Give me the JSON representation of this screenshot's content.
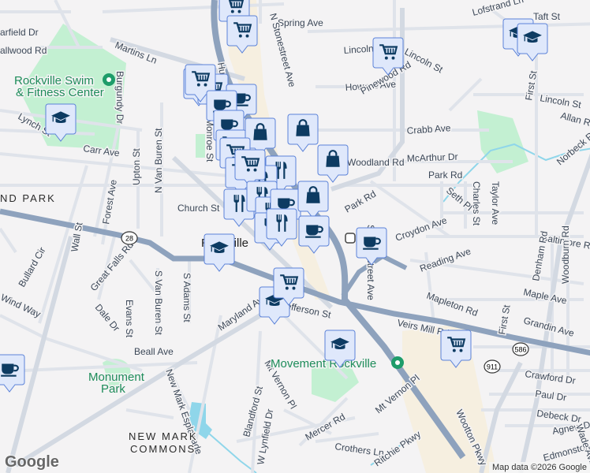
{
  "map": {
    "labels": [
      {
        "text": "Martins Ln"
      },
      {
        "text": "Rockville Swim"
      },
      {
        "text": "& Fitness Center"
      },
      {
        "text": "arfield Dr"
      },
      {
        "text": "allwood Rd"
      },
      {
        "text": "Lynch St"
      },
      {
        "text": "Carr Ave"
      },
      {
        "text": "Upton St"
      },
      {
        "text": "N Van Buren St"
      },
      {
        "text": "Forest Ave"
      },
      {
        "text": "ND PARK"
      },
      {
        "text": "Spring Ave"
      },
      {
        "text": "Lincoln St"
      },
      {
        "text": "Lincoln St"
      },
      {
        "text": "Howard Ave"
      },
      {
        "text": "Burgundy Dr"
      },
      {
        "text": "Pinewood Rd"
      },
      {
        "text": "Crabb Ave"
      },
      {
        "text": "McArthur Dr"
      },
      {
        "text": "Woodland Rd"
      },
      {
        "text": "Park Rd"
      },
      {
        "text": "Park Rd"
      },
      {
        "text": "Seth Pl"
      },
      {
        "text": "Charles St"
      },
      {
        "text": "Taylor Ave"
      },
      {
        "text": "Lofstrand Ln"
      },
      {
        "text": "Taft St"
      },
      {
        "text": "First St"
      },
      {
        "text": "Lincoln St"
      },
      {
        "text": "Allan Rd"
      },
      {
        "text": "Norbeck Rd"
      },
      {
        "text": "Baltimore Rd"
      },
      {
        "text": "Croydon Ave"
      },
      {
        "text": "Reading Ave"
      },
      {
        "text": "Mapleton Rd"
      },
      {
        "text": "Denham Rd"
      },
      {
        "text": "Woodburn Rd"
      },
      {
        "text": "Maple Ave"
      },
      {
        "text": "Grandin Ave"
      },
      {
        "text": "First St"
      },
      {
        "text": "Veirs Mill Rd"
      },
      {
        "text": "Crawford Dr"
      },
      {
        "text": "Paul Dr"
      },
      {
        "text": "Debeck Dr"
      },
      {
        "text": "Agnew Dr"
      },
      {
        "text": "Edmonston Dr"
      },
      {
        "text": "Wade Ave"
      },
      {
        "text": "Rockville"
      },
      {
        "text": "Great Falls Rd"
      },
      {
        "text": "Wall St"
      },
      {
        "text": "Bullard Cir"
      },
      {
        "text": "Wind Way"
      },
      {
        "text": "Evans St"
      },
      {
        "text": "S Van Buren St"
      },
      {
        "text": "S Adams St"
      },
      {
        "text": "Dale Dr"
      },
      {
        "text": "Maryland Ave"
      },
      {
        "text": "Monument"
      },
      {
        "text": "Park"
      },
      {
        "text": "New Mark Esplanade"
      },
      {
        "text": "NEW MARK"
      },
      {
        "text": "COMMONS"
      },
      {
        "text": "Blandford St"
      },
      {
        "text": "W Lynfield Dr"
      },
      {
        "text": "Mt Vernon Pl"
      },
      {
        "text": "Mt Vernon Pl"
      },
      {
        "text": "Movement Rockville"
      },
      {
        "text": "Mercer Rd"
      },
      {
        "text": "Crothers Ln"
      },
      {
        "text": "Ritchie Pkwy"
      },
      {
        "text": "Wootton Pkwy"
      },
      {
        "text": "E Jefferson St"
      },
      {
        "text": "Beall Ave"
      },
      {
        "text": "Hungerford Dr"
      },
      {
        "text": "Carr Ave"
      },
      {
        "text": "Monroe St"
      },
      {
        "text": "Forest Ave"
      },
      {
        "text": "S Stonestreet Ave"
      },
      {
        "text": "Dr"
      },
      {
        "text": "Church St"
      },
      {
        "text": "N Stonestreet Ave"
      },
      {
        "text": "Rockville"
      }
    ],
    "shields": [
      "28",
      "586",
      "911"
    ],
    "markers": [
      "cart",
      "cart",
      "cart",
      "cart",
      "cart",
      "cup",
      "cart",
      "cup",
      "cup",
      "bag",
      "bag",
      "cart",
      "bag",
      "cart",
      "cart",
      "fork",
      "fork",
      "cart",
      "fork",
      "fork",
      "fork",
      "cup",
      "fork",
      "fork",
      "bag",
      "cup",
      "cup",
      "grad",
      "grad",
      "grad",
      "grad",
      "grad",
      "grad",
      "cart",
      "cart",
      "cup"
    ],
    "colors": {
      "marker_bg": "#dfe8fb",
      "marker_border": "#5b82d8",
      "glyph": "#0d3b62",
      "highway": "#8ea2bd",
      "park": "#c3f0d2",
      "commercial": "#f6efe0",
      "water": "#8fd6ea"
    }
  },
  "footer": {
    "attribution": "Map data ©2026 Google",
    "logo": "Google"
  }
}
